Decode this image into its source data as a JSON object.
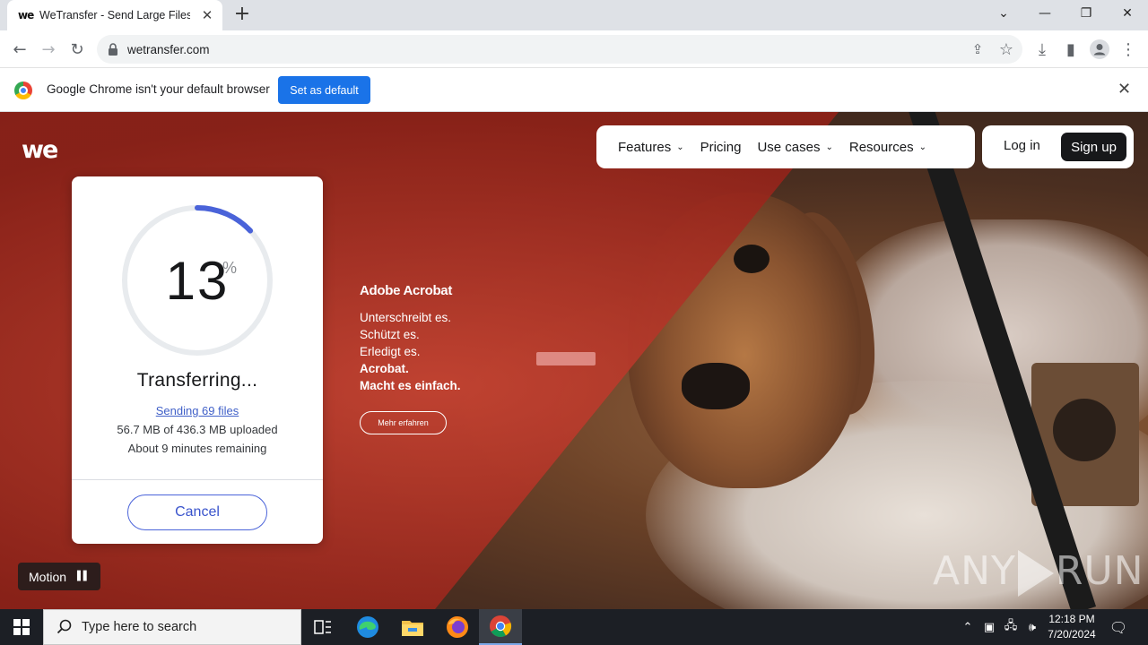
{
  "browser": {
    "tab_title": "WeTransfer - Send Large Files &",
    "favicon_text": "we",
    "new_tab_symbol": "+",
    "url": "wetransfer.com"
  },
  "infobar": {
    "message": "Google Chrome isn't your default browser",
    "button_label": "Set as default"
  },
  "site": {
    "logo_text": "we",
    "nav": [
      {
        "label": "Features",
        "has_menu": true
      },
      {
        "label": "Pricing",
        "has_menu": false
      },
      {
        "label": "Use cases",
        "has_menu": true
      },
      {
        "label": "Resources",
        "has_menu": true
      }
    ],
    "login_label": "Log in",
    "signup_label": "Sign up"
  },
  "transfer": {
    "percent": "13",
    "percent_sign": "%",
    "progress_fraction": 0.13,
    "status": "Transferring...",
    "sending": "Sending 69 files",
    "uploaded": "56.7 MB of 436.3 MB uploaded",
    "remaining": "About 9 minutes remaining",
    "cancel_label": "Cancel"
  },
  "ad": {
    "brand": "Adobe Acrobat",
    "lines": [
      "Unterschreibt es.",
      "Schützt es.",
      "Erledigt es."
    ],
    "bold_lines": [
      "Acrobat.",
      "Macht es einfach."
    ],
    "cta": "Mehr erfahren"
  },
  "motion": {
    "label": "Motion"
  },
  "watermark": {
    "left": "ANY",
    "right": "RUN"
  },
  "taskbar": {
    "search_placeholder": "Type here to search",
    "time": "12:18 PM",
    "date": "7/20/2024"
  },
  "colors": {
    "accent_blue": "#4a63d9",
    "chrome_button": "#1a73e8",
    "hero_red": "#b42f20",
    "ring_track": "#e8ebee"
  }
}
